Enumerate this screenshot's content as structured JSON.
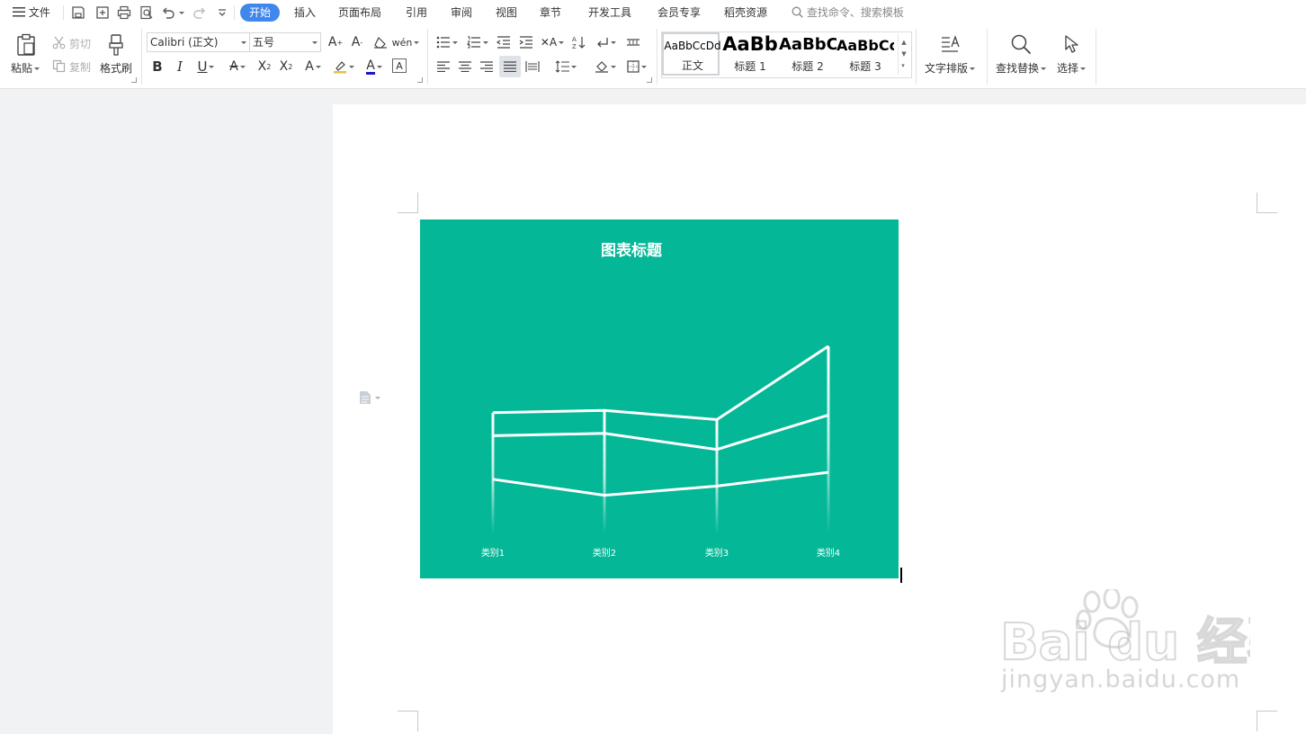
{
  "menu": {
    "file": "文件",
    "tabs": [
      "开始",
      "插入",
      "页面布局",
      "引用",
      "审阅",
      "视图",
      "章节",
      "开发工具",
      "会员专享",
      "稻壳资源"
    ],
    "search_placeholder": "查找命令、搜索模板",
    "active_color": "#3f87ed"
  },
  "ribbon": {
    "paste": "粘贴",
    "cut": "剪切",
    "copy": "复制",
    "format_painter": "格式刷",
    "font_name": "Calibri (正文)",
    "font_size": "五号",
    "styles": [
      {
        "preview": "AaBbCcDd",
        "name": "正文"
      },
      {
        "preview": "AaBb",
        "name": "标题 1"
      },
      {
        "preview": "AaBbC",
        "name": "标题 2"
      },
      {
        "preview": "AaBbCc",
        "name": "标题 3"
      }
    ],
    "text_layout": "文字排版",
    "find_replace": "查找替换",
    "select": "选择"
  },
  "chart_data": {
    "type": "line",
    "title": "图表标题",
    "categories": [
      "类别1",
      "类别2",
      "类别3",
      "类别4"
    ],
    "series": [
      {
        "values": [
          2.4,
          1.7,
          2.1,
          2.7
        ]
      },
      {
        "values": [
          4.3,
          4.4,
          3.7,
          5.2
        ]
      },
      {
        "values": [
          5.3,
          5.4,
          5.0,
          8.2
        ]
      }
    ],
    "background": "#03b797",
    "line_color": "#ffffff",
    "grid": false
  },
  "watermark": {
    "brand": "Bai du 经验",
    "url": "jingyan.baidu.com"
  }
}
